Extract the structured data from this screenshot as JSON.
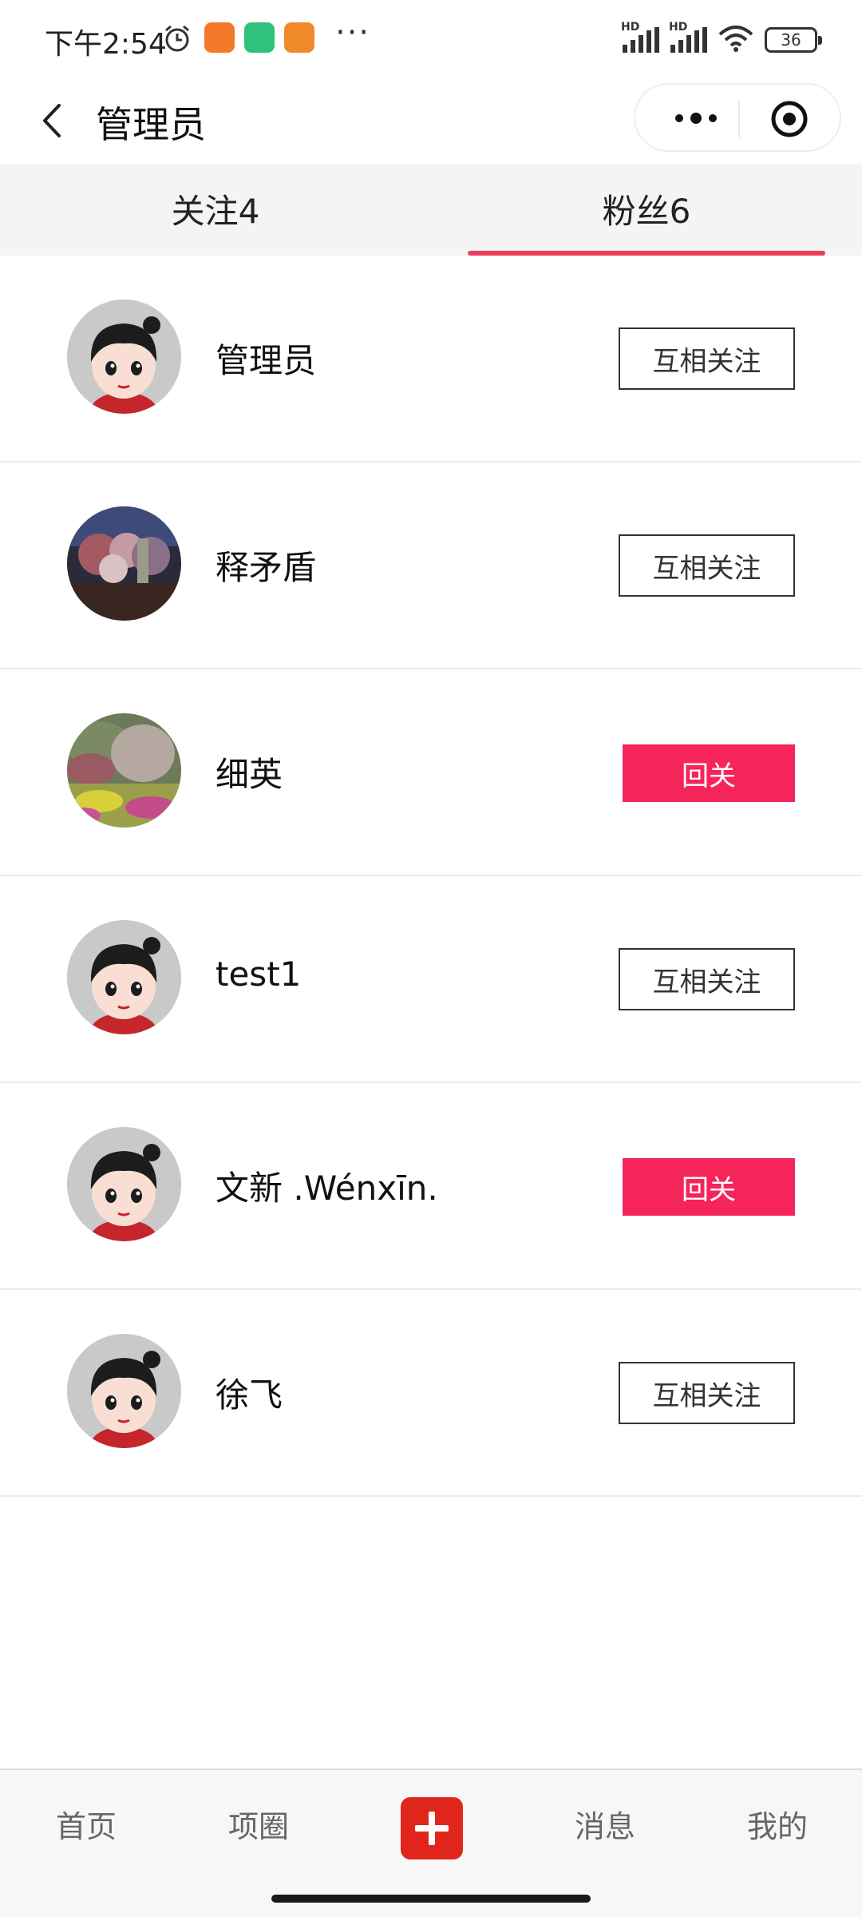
{
  "status_bar": {
    "time": "下午2:54",
    "more": "···",
    "battery": "36",
    "signal_label": "HD"
  },
  "nav": {
    "title": "管理员"
  },
  "tabs": [
    {
      "label": "关注4",
      "active": false
    },
    {
      "label": "粉丝6",
      "active": true
    }
  ],
  "followers": [
    {
      "name": "管理员",
      "action": "互相关注",
      "avatar": "cartoon-girl"
    },
    {
      "name": "释矛盾",
      "action": "互相关注",
      "avatar": "photo-flowers-dark"
    },
    {
      "name": "细英",
      "action": "回关",
      "avatar": "photo-flower-bush"
    },
    {
      "name": "test1",
      "action": "互相关注",
      "avatar": "cartoon-girl"
    },
    {
      "name": "文新 .Wénxīn.",
      "action": "回关",
      "avatar": "cartoon-girl"
    },
    {
      "name": "徐飞",
      "action": "互相关注",
      "avatar": "cartoon-girl"
    }
  ],
  "bottom_nav": [
    {
      "label": "首页"
    },
    {
      "label": "项圈"
    },
    {
      "label": "消息"
    },
    {
      "label": "我的"
    }
  ],
  "colors": {
    "accent_red": "#f5255a",
    "tab_indicator": "#ec3e5f",
    "add_button": "#e0261c"
  }
}
